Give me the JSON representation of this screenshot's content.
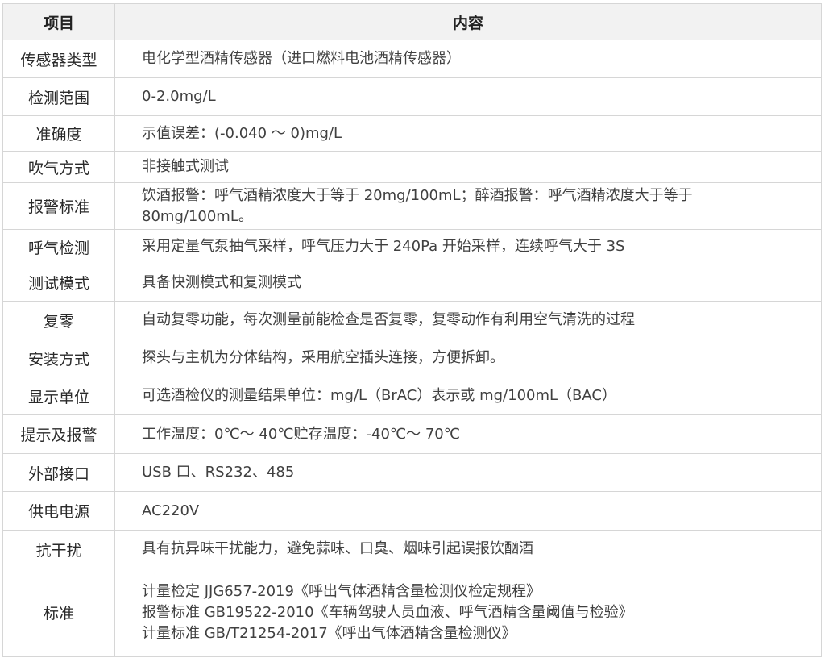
{
  "header": {
    "item": "项目",
    "content": "内容"
  },
  "rows": [
    {
      "item": "传感器类型",
      "lines": [
        "电化学型酒精传感器（进口燃料电池酒精传感器）"
      ]
    },
    {
      "item": "检测范围",
      "lines": [
        "0-2.0mg/L"
      ]
    },
    {
      "item": "准确度",
      "lines": [
        "示值误差：(-0.040 ～ 0)mg/L"
      ]
    },
    {
      "item": "吹气方式",
      "lines": [
        "非接触式测试"
      ]
    },
    {
      "item": "报警标准",
      "lines": [
        "饮酒报警：呼气酒精浓度大于等于 20mg/100mL；醉酒报警：呼气酒精浓度大于等于",
        "80mg/100mL。"
      ]
    },
    {
      "item": "呼气检测",
      "lines": [
        "采用定量气泵抽气采样，呼气压力大于 240Pa 开始采样，连续呼气大于 3S"
      ]
    },
    {
      "item": "测试模式",
      "lines": [
        "具备快测模式和复测模式"
      ]
    },
    {
      "item": "复零",
      "lines": [
        "自动复零功能，每次测量前能检查是否复零，复零动作有利用空气清洗的过程"
      ]
    },
    {
      "item": "安装方式",
      "lines": [
        "探头与主机为分体结构，采用航空插头连接，方便拆卸。"
      ]
    },
    {
      "item": "显示单位",
      "lines": [
        "可选酒检仪的测量结果单位：mg/L（BrAC）表示或 mg/100mL（BAC）"
      ]
    },
    {
      "item": "提示及报警",
      "lines": [
        "工作温度：0℃～ 40℃贮存温度：-40℃～ 70℃"
      ]
    },
    {
      "item": "外部接口",
      "lines": [
        "USB 口、RS232、485"
      ]
    },
    {
      "item": "供电电源",
      "lines": [
        "AC220V"
      ]
    },
    {
      "item": "抗干扰",
      "lines": [
        "具有抗异味干扰能力，避免蒜味、口臭、烟味引起误报饮酗酒"
      ]
    },
    {
      "item": "标准",
      "lines": [
        "计量检定 JJG657-2019《呼出气体酒精含量检测仪检定规程》",
        "报警标准 GB19522-2010《车辆驾驶人员血液、呼气酒精含量阈值与检验》",
        "计量标准 GB/T21254-2017《呼出气体酒精含量检测仪》"
      ]
    }
  ]
}
